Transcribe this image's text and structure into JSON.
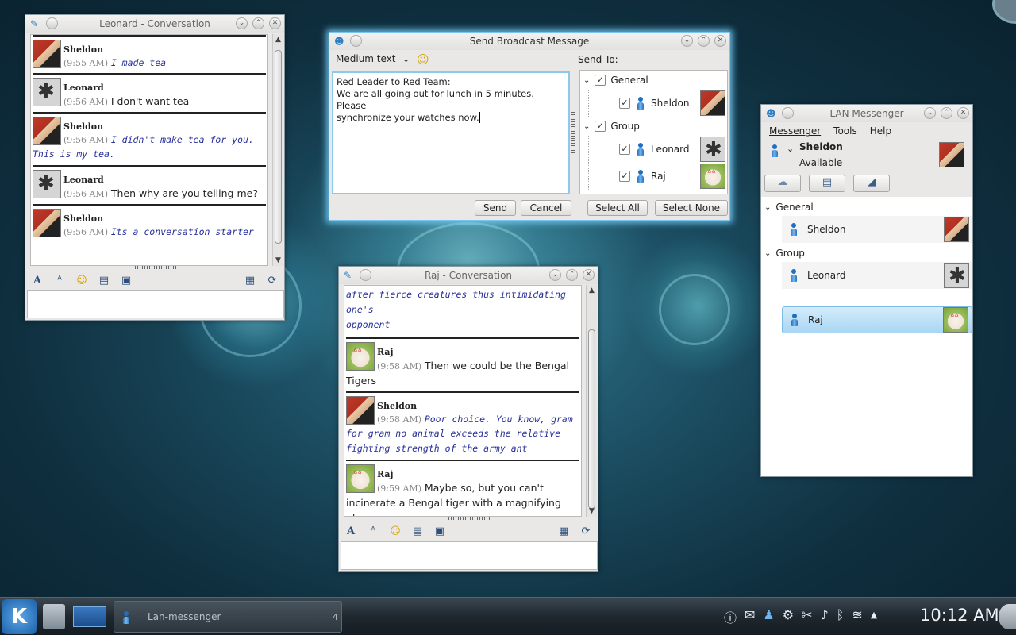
{
  "leonard_window": {
    "title": "Leonard - Conversation",
    "messages": [
      {
        "sender": "Sheldon",
        "time": "(9:55 AM)",
        "line1": "I made tea",
        "line2": "",
        "avatar": "spock",
        "style": "comic"
      },
      {
        "sender": "Leonard",
        "time": "(9:56 AM)",
        "line1": "I don't want tea",
        "line2": "",
        "avatar": "leonard",
        "style": "plain"
      },
      {
        "sender": "Sheldon",
        "time": "(9:56 AM)",
        "line1": "I didn't make tea for you.",
        "line2": "This is my tea.",
        "avatar": "spock",
        "style": "comic"
      },
      {
        "sender": "Leonard",
        "time": "(9:56 AM)",
        "line1": "Then why are you telling me?",
        "line2": "",
        "avatar": "leonard",
        "style": "plain"
      },
      {
        "sender": "Sheldon",
        "time": "(9:56 AM)",
        "line1": "Its a conversation starter",
        "line2": "",
        "avatar": "spock",
        "style": "comic"
      }
    ]
  },
  "broadcast_window": {
    "title": "Send Broadcast Message",
    "font_select": "Medium text",
    "send_to_label": "Send To:",
    "message_lines": [
      "Red Leader to Red Team:",
      "We are all going out for lunch in 5 minutes. Please",
      "synchronize your watches now."
    ],
    "groups": [
      {
        "name": "General",
        "members": [
          "Sheldon"
        ]
      },
      {
        "name": "Group",
        "members": [
          "Leonard",
          "Raj"
        ]
      }
    ],
    "send_label": "Send",
    "cancel_label": "Cancel",
    "select_all_label": "Select All",
    "select_none_label": "Select None"
  },
  "raj_window": {
    "title": "Raj - Conversation",
    "top_fragment": [
      "after fierce creatures thus intimidating one's",
      "opponent"
    ],
    "messages": [
      {
        "sender": "Raj",
        "time": "(9:58 AM)",
        "line1": "Then we could be the Bengal",
        "line2": "Tigers",
        "avatar": "raj",
        "style": "plain"
      },
      {
        "sender": "Sheldon",
        "time": "(9:58 AM)",
        "line1": "Poor choice. You know, gram",
        "line2": "for gram no animal exceeds the relative",
        "line3": "fighting strength of the army ant",
        "avatar": "spock",
        "style": "comic"
      },
      {
        "sender": "Raj",
        "time": "(9:59 AM)",
        "line1": "Maybe so, but you can't",
        "line2": "incinerate a Bengal tiger with a magnifying",
        "line3": "glass",
        "avatar": "raj",
        "style": "plain"
      }
    ]
  },
  "lan_window": {
    "title": "LAN Messenger",
    "menu": [
      "Messenger",
      "Tools",
      "Help"
    ],
    "user_name": "Sheldon",
    "user_status": "Available",
    "groups": [
      {
        "name": "General",
        "members": [
          "Sheldon"
        ]
      },
      {
        "name": "Group",
        "members": [
          "Leonard",
          "Raj"
        ]
      }
    ],
    "selected_member": "Raj"
  },
  "taskbar": {
    "task_label": "Lan-messenger",
    "task_count": "4",
    "clock": "10:12 AM"
  },
  "colors": {
    "accent": "#7cc4ee",
    "selection": "#bfe0f5",
    "comic_text": "#28309a"
  }
}
